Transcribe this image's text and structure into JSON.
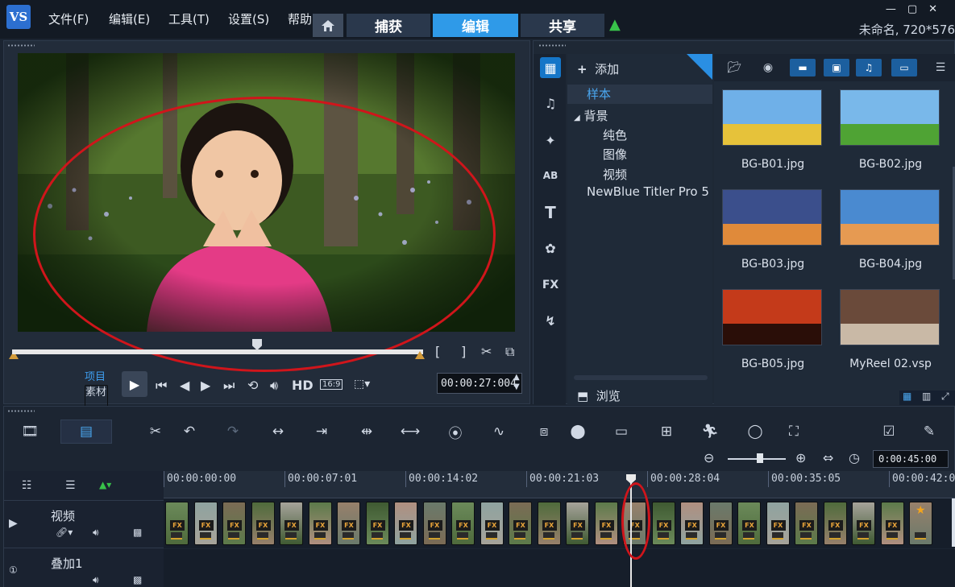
{
  "app": {
    "logo_text": "VS",
    "menu": [
      "文件(F)",
      "编辑(E)",
      "工具(T)",
      "设置(S)",
      "帮助"
    ],
    "tabs": [
      {
        "label": "捕获",
        "active": false
      },
      {
        "label": "编辑",
        "active": true
      },
      {
        "label": "共享",
        "active": false
      }
    ],
    "window_controls": "—▢✕",
    "project_name": "未命名, 720*576"
  },
  "preview": {
    "mode_project": "项目",
    "mode_clip": "素材",
    "hd_label": "HD",
    "aspect_label": "16:9",
    "timecode": "00:00:27:004",
    "colors": {
      "accent": "#2f9ae8",
      "annotation": "#d0151b"
    }
  },
  "library": {
    "add_label": "添加",
    "tree": {
      "sample": "样本",
      "background": "背景",
      "children": [
        "纯色",
        "图像",
        "视频"
      ],
      "titler": "NewBlue Titler Pro 5"
    },
    "browse_label": "浏览",
    "sidebar_icons": [
      "media-icon",
      "audio-icon",
      "transition-icon",
      "title-icon",
      "text-icon",
      "graphic-icon",
      "fx-icon",
      "path-icon"
    ],
    "thumbnails": [
      {
        "name": "BG-B01.jpg",
        "sky": "#6fb0e8",
        "ground": "#e6c23a"
      },
      {
        "name": "BG-B02.jpg",
        "sky": "#79b8ea",
        "ground": "#4fa334"
      },
      {
        "name": "BG-B03.jpg",
        "sky": "#3b4f8c",
        "ground": "#e08a3a"
      },
      {
        "name": "BG-B04.jpg",
        "sky": "#4a8ad0",
        "ground": "#e69a52"
      },
      {
        "name": "BG-B05.jpg",
        "sky": "#c43a1a",
        "ground": "#2a0e08"
      },
      {
        "name": "MyReel 02.vsp",
        "sky": "#6a4a3a",
        "ground": "#c9b9a6"
      }
    ]
  },
  "timeline": {
    "timecode": "0:00:45:00",
    "ruler": [
      "00:00:00:00",
      "00:00:07:01",
      "00:00:14:02",
      "00:00:21:03",
      "00:00:28:04",
      "00:00:35:05",
      "00:00:42:06"
    ],
    "tracks": [
      {
        "name": "视频"
      },
      {
        "name": "叠加1"
      }
    ],
    "fx_label": "FX",
    "clip_count": 27,
    "playhead_seconds": 27
  }
}
